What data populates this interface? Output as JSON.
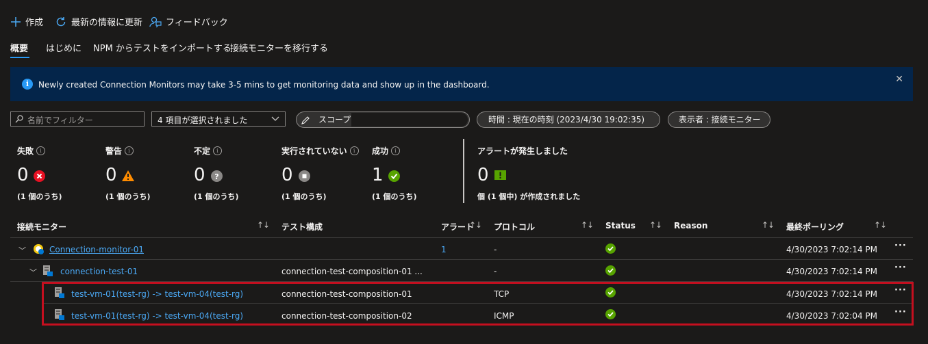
{
  "toolbar": {
    "create": "作成",
    "refresh": "最新の情報に更新",
    "feedback": "フィードバック"
  },
  "tabs": [
    "概要",
    "はじめに",
    "NPM からテストをインポートする",
    "接続モニターを移行する"
  ],
  "banner": {
    "text": "Newly created Connection Monitors may take 3-5 mins to get monitoring data and show up in the dashboard."
  },
  "filters": {
    "search_placeholder": "名前でフィルター",
    "dropdown_value": "4 項目が選択されました",
    "scope_label": "スコープ :",
    "time_label": "時間 : 現在の時刻 (2023/4/30 19:02:35)",
    "view_label": "表示者 : 接続モニター"
  },
  "summary": [
    {
      "label": "失敗",
      "value": "0",
      "sub": "(1 個のうち)",
      "icon": "error-icon"
    },
    {
      "label": "警告",
      "value": "0",
      "sub": "(1 個のうち)",
      "icon": "warning-icon"
    },
    {
      "label": "不定",
      "value": "0",
      "sub": "(1 個のうち)",
      "icon": "unknown-icon"
    },
    {
      "label": "実行されていない",
      "value": "0",
      "sub": "(1 個のうち)",
      "icon": "stopped-icon"
    },
    {
      "label": "成功",
      "value": "1",
      "sub": "(1 個のうち)",
      "icon": "success-icon"
    }
  ],
  "alerts": {
    "label": "アラートが発生しました",
    "value": "0",
    "sub": "個 (1 個中) が作成されました"
  },
  "table": {
    "headers": [
      "接続モニター",
      "テスト構成",
      "アラート",
      "プロトコル",
      "Status",
      "Reason",
      "最終ポーリング"
    ],
    "rows": [
      {
        "name": "Connection-monitor-01",
        "config": "",
        "alerts": "1",
        "protocol": "-",
        "status": "success",
        "reason": "",
        "polled": "4/30/2023 7:02:14 PM"
      },
      {
        "name": "connection-test-01",
        "config": "connection-test-composition-01 ...",
        "alerts": "",
        "protocol": "-",
        "status": "success",
        "reason": "",
        "polled": "4/30/2023 7:02:14 PM"
      },
      {
        "name": "test-vm-01(test-rg) -> test-vm-04(test-rg)",
        "config": "connection-test-composition-01",
        "alerts": "",
        "protocol": "TCP",
        "status": "success",
        "reason": "",
        "polled": "4/30/2023 7:02:14 PM"
      },
      {
        "name": "test-vm-01(test-rg) -> test-vm-04(test-rg)",
        "config": "connection-test-composition-02",
        "alerts": "",
        "protocol": "ICMP",
        "status": "success",
        "reason": "",
        "polled": "4/30/2023 7:02:04 PM"
      }
    ],
    "more_label": "···"
  },
  "colors": {
    "background": "#1b1a19",
    "accent": "#2899f5",
    "link": "#4ba9f5",
    "success": "#57a300",
    "error": "#e81123",
    "warning": "#fce100",
    "highlight_border": "#c50f1f"
  }
}
